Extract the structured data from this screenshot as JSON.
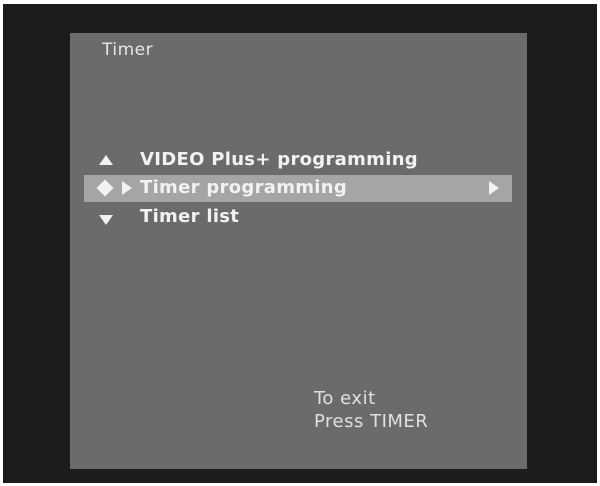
{
  "screen": {
    "title": "Timer"
  },
  "menu": {
    "items": [
      {
        "label": "VIDEO Plus+ programming",
        "nav_icon": "up-arrow-icon",
        "selected": false
      },
      {
        "label": "Timer programming",
        "nav_icon": "diamond-cursor-icon",
        "selected": true,
        "submenu_icon": "right-arrow-icon"
      },
      {
        "label": "Timer list",
        "nav_icon": "down-arrow-icon",
        "selected": false
      }
    ]
  },
  "footer": {
    "line1": "To exit",
    "line2": "Press TIMER"
  },
  "colors": {
    "bezel": "#1c1c1c",
    "screen": "#6b6b6b",
    "highlight": "#a5a5a5",
    "text": "#f2f2f2"
  }
}
